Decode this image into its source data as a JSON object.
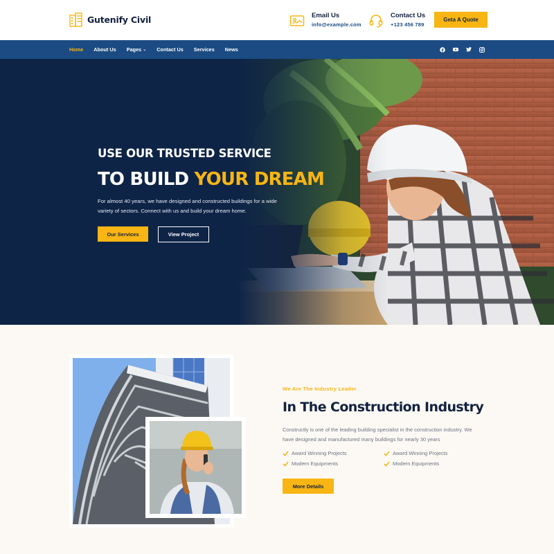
{
  "brand": {
    "name": "Gutenify Civil"
  },
  "header": {
    "email": {
      "title": "Email Us",
      "value": "info@example.com",
      "icon": "mail-icon"
    },
    "phone": {
      "title": "Contact Us",
      "value": "+123 456 789",
      "icon": "headset-icon"
    },
    "quote_button": "Geta A Quote"
  },
  "nav": {
    "items": [
      {
        "label": "Home",
        "active": true
      },
      {
        "label": "About Us"
      },
      {
        "label": "Pages",
        "dropdown": true
      },
      {
        "label": "Contact Us"
      },
      {
        "label": "Services"
      },
      {
        "label": "News"
      }
    ],
    "social": [
      "facebook-icon",
      "youtube-icon",
      "twitter-icon",
      "instagram-icon"
    ]
  },
  "hero": {
    "subtitle": "USE OUR TRUSTED SERVICE",
    "title_plain": "TO BUILD ",
    "title_highlight": "YOUR DREAM",
    "description": "For almost 40 years, we have designed and constructed buildings for a wide variety of sectors. Connect with us and build your dream home.",
    "primary_button": "Our Services",
    "secondary_button": "View Project"
  },
  "about": {
    "eyebrow": "We Are The Industry Leader",
    "title": "In The Construction Industry",
    "description": "Constructly is one of the leading building specialist in the construction industry. We have designed and manufactured many buildings for nearly 30 years",
    "features": [
      "Award Winning Projects",
      "Award Winning Projects",
      "Modern Equipments",
      "Modern Equipments"
    ],
    "button": "More Details"
  },
  "colors": {
    "accent": "#f8b513",
    "navy": "#12213f",
    "nav_bg": "#1b4b82",
    "hero_bg": "#0e2447",
    "section_bg": "#fcf9f4"
  }
}
